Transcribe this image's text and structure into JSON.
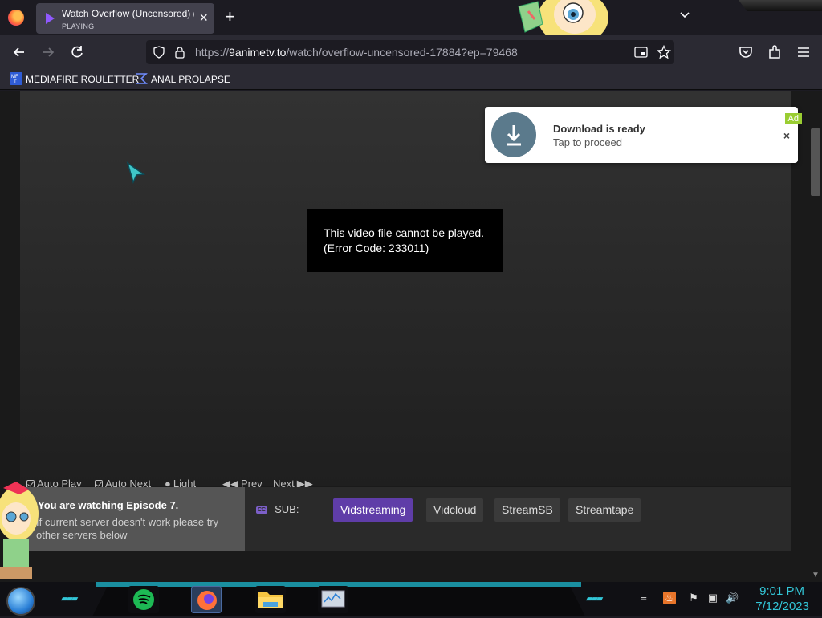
{
  "browser": {
    "tab": {
      "title": "Watch Overflow (Uncensored) (",
      "status": "PLAYING",
      "close": "×"
    },
    "new_tab": "+",
    "url": {
      "prefix": "https://",
      "domain": "9animetv.to",
      "path": "/watch/overflow-uncensored-17884?ep=79468"
    },
    "bookmarks": [
      {
        "label": "MEDIAFIRE ROULETTER",
        "icon": "mediafire-icon"
      },
      {
        "label": "ANAL PROLAPSE",
        "icon": "sigma-icon"
      }
    ]
  },
  "player": {
    "error_line1": "This video file cannot be played.",
    "error_line2": "(Error Code: 233011)"
  },
  "controls": {
    "auto_play": "Auto Play",
    "auto_next": "Auto Next",
    "light": "Light",
    "prev": "Prev",
    "next": "Next"
  },
  "episode": {
    "title": "You are watching Episode 7.",
    "note": "If current server doesn't work please try other servers below"
  },
  "servers": {
    "sub_label": "SUB:",
    "cc_badge": "CC",
    "items": [
      "Vidstreaming",
      "Vidcloud",
      "StreamSB",
      "Streamtape"
    ],
    "active": "Vidstreaming"
  },
  "ad": {
    "title": "Download is ready",
    "subtitle": "Tap to proceed",
    "badge": "Ad",
    "close": "×"
  },
  "taskbar": {
    "time": "9:01 PM",
    "date": "7/12/2023"
  },
  "colors": {
    "accent_purple": "#5f3da8",
    "teal_accent": "#33c7d8",
    "ad_badge": "#9acd32"
  }
}
